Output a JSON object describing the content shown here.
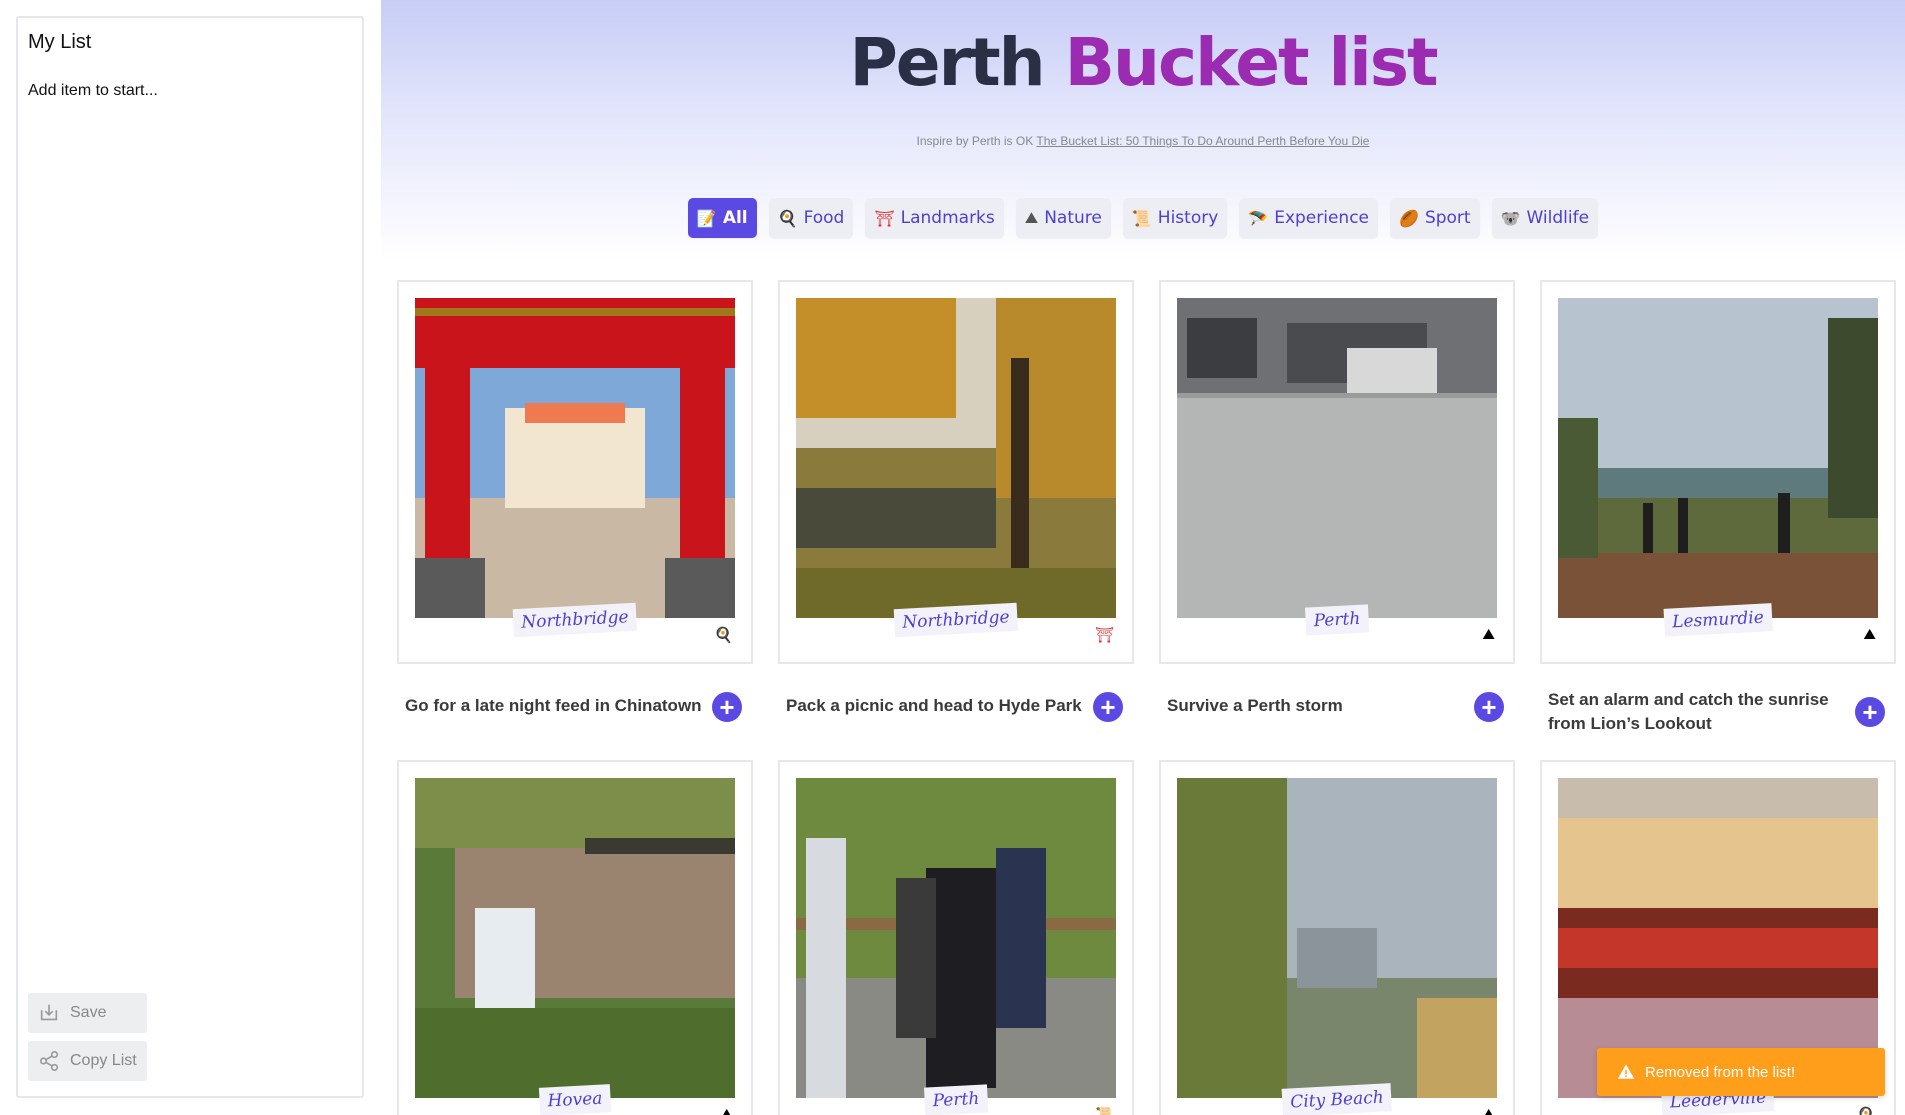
{
  "sidebar": {
    "title": "My List",
    "empty_text": "Add item to start...",
    "save_label": "Save",
    "copy_label": "Copy List"
  },
  "header": {
    "title_main": "Perth",
    "title_accent": "Bucket list",
    "subtitle_prefix": "Inspire by Perth is OK",
    "subtitle_link": "The Bucket List: 50 Things To Do Around Perth Before You Die"
  },
  "filters": [
    {
      "icon": "📝",
      "label": "All",
      "active": true
    },
    {
      "icon": "🍳",
      "label": "Food"
    },
    {
      "icon": "⛩",
      "label": "Landmarks"
    },
    {
      "icon": "⛰",
      "label": "Nature"
    },
    {
      "icon": "📜",
      "label": "History"
    },
    {
      "icon": "🪂",
      "label": "Experience"
    },
    {
      "icon": "🏉",
      "label": "Sport"
    },
    {
      "icon": "🐨",
      "label": "Wildlife"
    }
  ],
  "cards": [
    {
      "location": "Northbridge",
      "category_icon": "🍳",
      "title": "Go for a late night feed in Chinatown"
    },
    {
      "location": "Northbridge",
      "category_icon": "⛩",
      "title": "Pack a picnic and head to Hyde Park"
    },
    {
      "location": "Perth",
      "category_icon": "⛰",
      "title": "Survive a Perth storm"
    },
    {
      "location": "Lesmurdie",
      "category_icon": "⛰",
      "title": "Set an alarm and catch the sunrise from Lion’s Lookout"
    },
    {
      "location": "Hovea",
      "category_icon": "⛰",
      "title": ""
    },
    {
      "location": "Perth",
      "category_icon": "📜",
      "title": ""
    },
    {
      "location": "City Beach",
      "category_icon": "⛰",
      "title": ""
    },
    {
      "location": "Leederville",
      "category_icon": "🍳",
      "title": ""
    }
  ],
  "add_icon": "plus-icon",
  "toast": {
    "text": "Removed from the list!",
    "color": "#ff9e1b"
  }
}
